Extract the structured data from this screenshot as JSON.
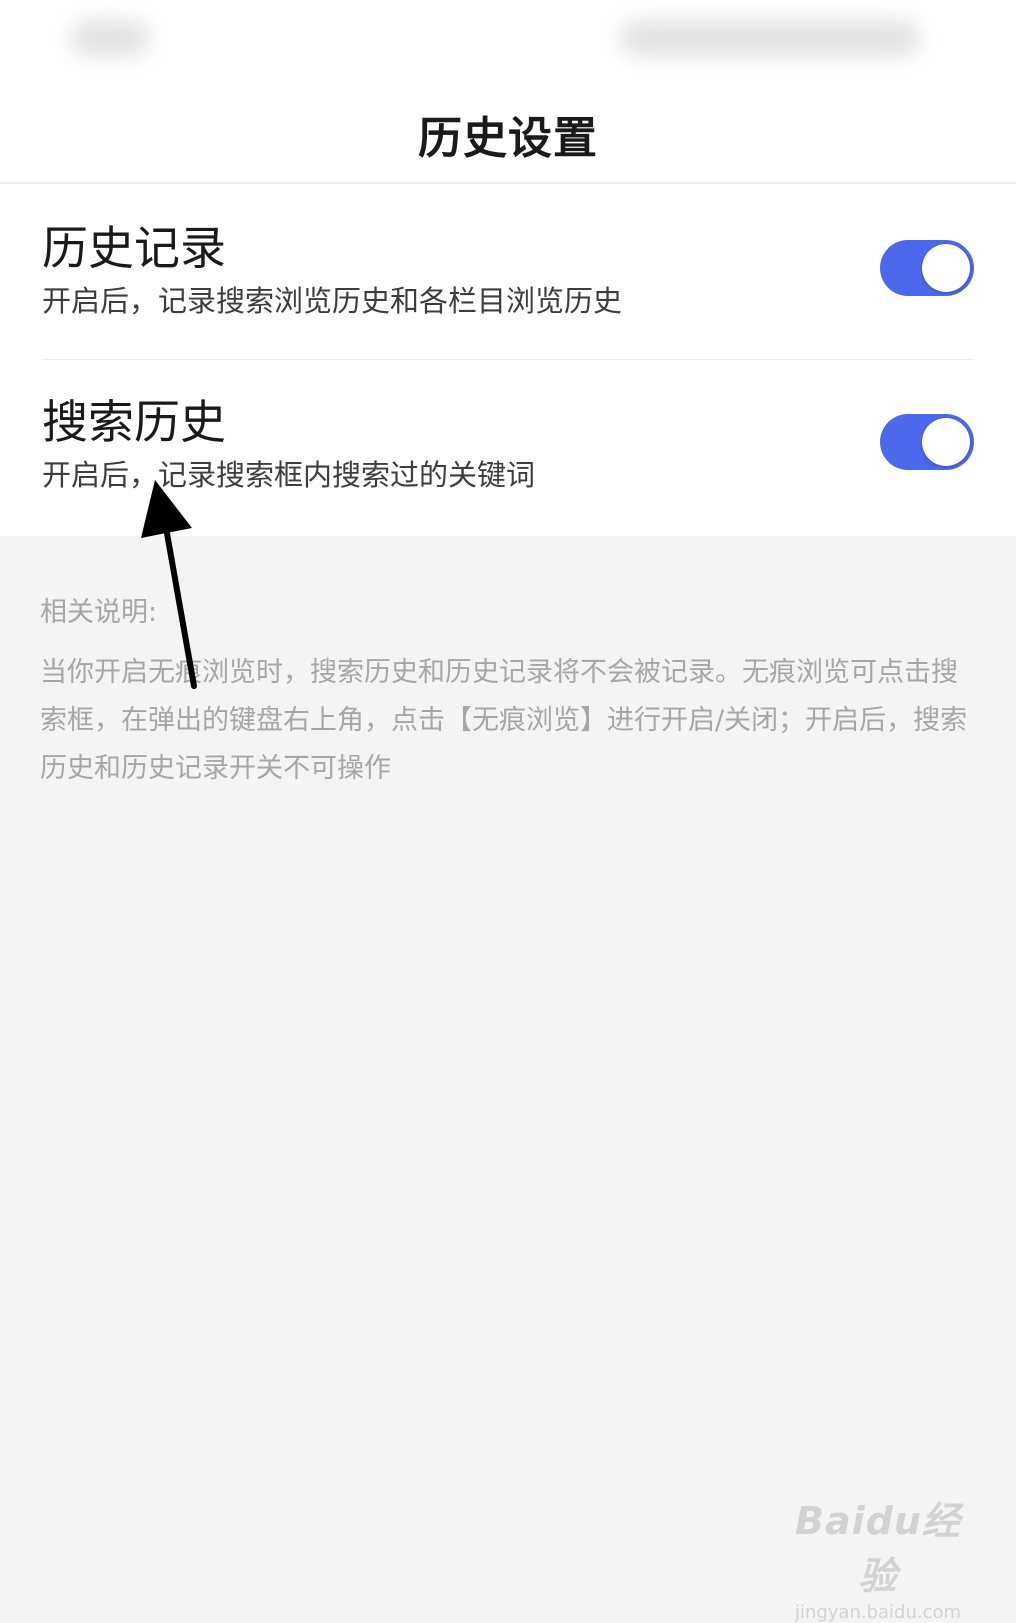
{
  "header": {
    "title": "历史设置"
  },
  "settings": [
    {
      "title": "历史记录",
      "description": "开启后，记录搜索浏览历史和各栏目浏览历史",
      "enabled": true
    },
    {
      "title": "搜索历史",
      "description": "开启后，记录搜索框内搜索过的关键词",
      "enabled": true
    }
  ],
  "notes": {
    "heading": "相关说明:",
    "text": "当你开启无痕浏览时，搜索历史和历史记录将不会被记录。无痕浏览可点击搜索框，在弹出的键盘右上角，点击【无痕浏览】进行开启/关闭；开启后，搜索历史和历史记录开关不可操作"
  },
  "colors": {
    "toggle_on": "#4c68ec",
    "background": "#f4f4f4"
  },
  "watermark": {
    "logo": "Baidu经验",
    "url": "jingyan.baidu.com"
  }
}
